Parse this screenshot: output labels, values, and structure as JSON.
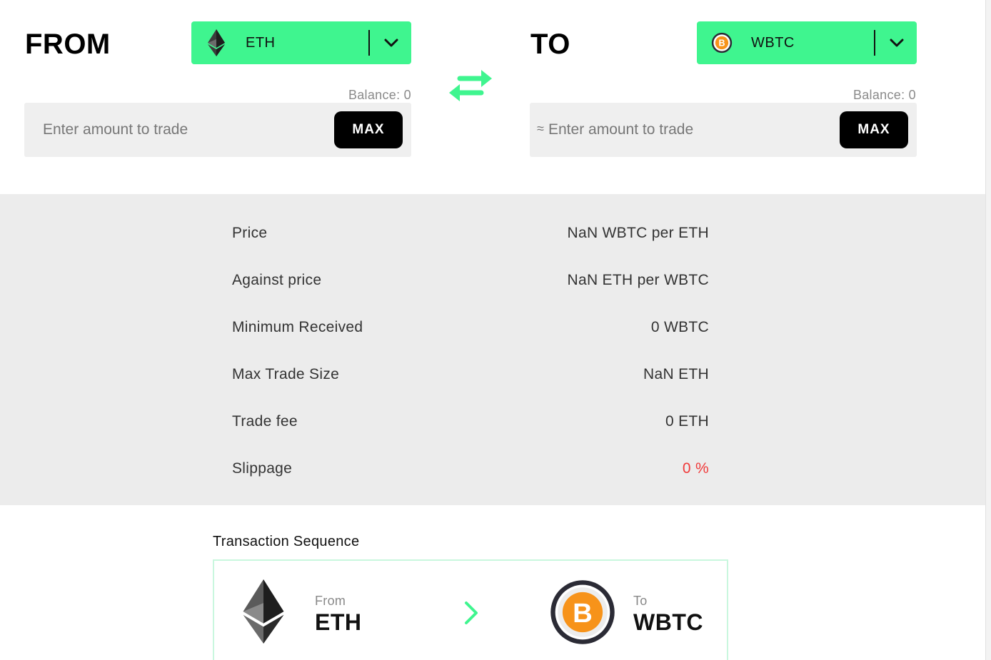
{
  "from": {
    "label": "FROM",
    "token": {
      "name": "ETH",
      "icon": "ethereum-icon"
    },
    "balance": "Balance: 0",
    "amount_placeholder": "Enter amount to trade",
    "max_label": "MAX"
  },
  "to": {
    "label": "TO",
    "token": {
      "name": "WBTC",
      "icon": "wbtc-icon"
    },
    "balance": "Balance: 0",
    "approx_symbol": "≈",
    "amount_placeholder": "Enter amount to trade",
    "max_label": "MAX"
  },
  "details": [
    {
      "label": "Price",
      "value": "NaN WBTC per ETH"
    },
    {
      "label": "Against price",
      "value": "NaN ETH per WBTC"
    },
    {
      "label": "Minimum Received",
      "value": "0 WBTC"
    },
    {
      "label": "Max Trade Size",
      "value": "NaN ETH"
    },
    {
      "label": "Trade fee",
      "value": "0 ETH"
    },
    {
      "label": "Slippage",
      "value": "0 %"
    }
  ],
  "sequence": {
    "title": "Transaction Sequence",
    "from_label": "From",
    "from_token": "ETH",
    "to_label": "To",
    "to_token": "WBTC"
  },
  "colors": {
    "accent": "#3ff58f",
    "slippage": "#f03a3a",
    "panel": "#ececec"
  }
}
